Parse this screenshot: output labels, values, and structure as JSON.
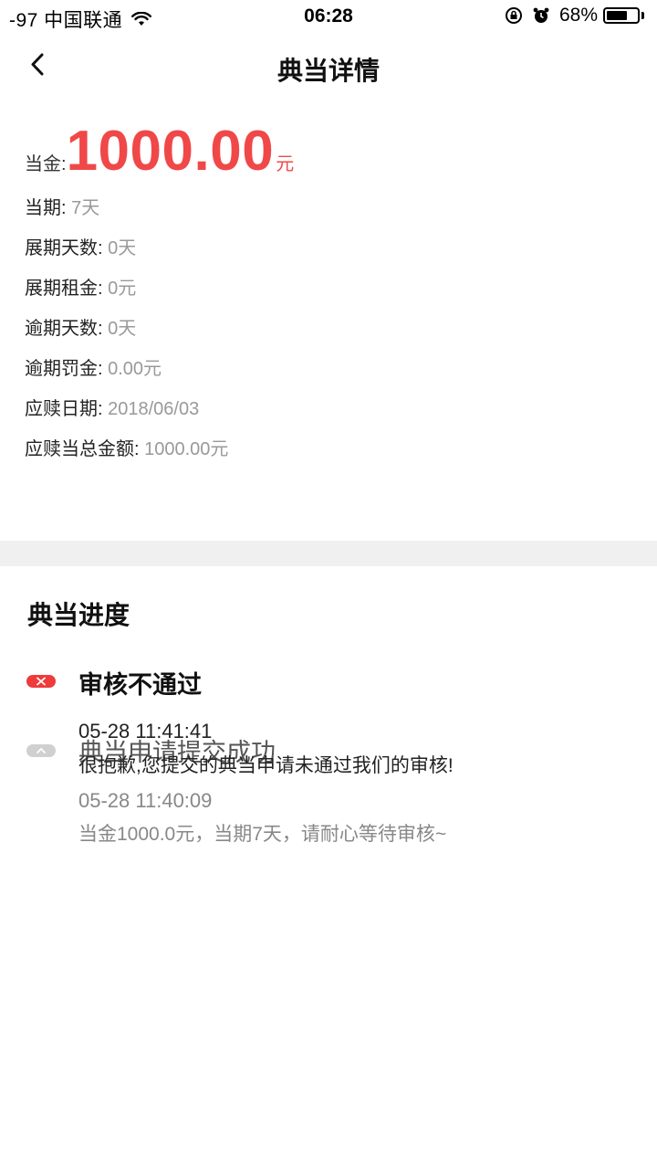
{
  "status_bar": {
    "carrier": "-97 中国联通",
    "time": "06:28",
    "battery_percent": "68%",
    "battery_level": 0.68
  },
  "nav": {
    "title": "典当详情"
  },
  "details": {
    "amount_label": "当金:",
    "amount_value": "1000.00",
    "amount_unit": "元",
    "rows": [
      {
        "label": "当期:",
        "value": "7天"
      },
      {
        "label": "展期天数:",
        "value": "0天"
      },
      {
        "label": "展期租金:",
        "value": "0元"
      },
      {
        "label": "逾期天数:",
        "value": "0天"
      },
      {
        "label": "逾期罚金:",
        "value": "0.00元"
      },
      {
        "label": "应赎日期:",
        "value": "2018/06/03"
      },
      {
        "label": "应赎当总金额:",
        "value": "1000.00元"
      }
    ]
  },
  "progress": {
    "title": "典当进度",
    "steps": [
      {
        "title": "审核不通过",
        "time": "05-28 11:41:41",
        "desc": "很抱歉,您提交的典当申请未通过我们的审核!"
      },
      {
        "title": "典当申请提交成功",
        "time": "05-28 11:40:09",
        "desc": "当金1000.0元，当期7天，请耐心等待审核~"
      }
    ]
  },
  "colors": {
    "accent_red": "#f04848",
    "divider_gray": "#f0f0f0",
    "muted_text": "#999999"
  }
}
